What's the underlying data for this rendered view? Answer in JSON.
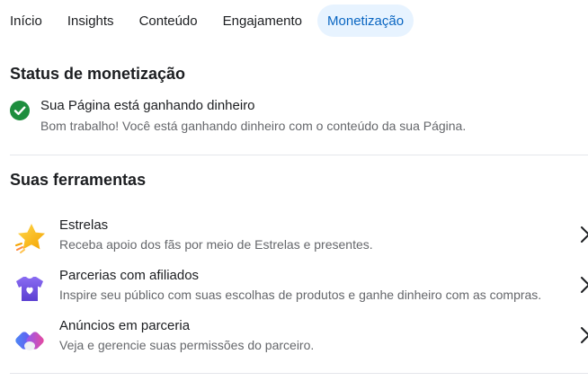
{
  "tabs": [
    {
      "label": "Início"
    },
    {
      "label": "Insights"
    },
    {
      "label": "Conteúdo"
    },
    {
      "label": "Engajamento"
    },
    {
      "label": "Monetização",
      "active": true
    }
  ],
  "status": {
    "section_title": "Status de monetização",
    "headline": "Sua Página está ganhando dinheiro",
    "subtext": "Bom trabalho! Você está ganhando dinheiro com o conteúdo da sua Página.",
    "icon": "check-circle-icon",
    "icon_color": "#1e8e3e"
  },
  "tools": {
    "section_title": "Suas ferramentas",
    "items": [
      {
        "title": "Estrelas",
        "description": "Receba apoio dos fãs por meio de Estrelas e presentes.",
        "icon": "star-icon"
      },
      {
        "title": "Parcerias com afiliados",
        "description": "Inspire seu público com suas escolhas de produtos e ganhe dinheiro com as compras.",
        "icon": "tshirt-icon"
      },
      {
        "title": "Anúncios em parceria",
        "description": "Veja e gerencie suas permissões do parceiro.",
        "icon": "partnership-ads-icon"
      }
    ]
  },
  "colors": {
    "accent": "#0a66c2",
    "active_tab_bg": "#e7f3ff",
    "text_primary": "#1c1e21",
    "text_secondary": "#65676b"
  }
}
